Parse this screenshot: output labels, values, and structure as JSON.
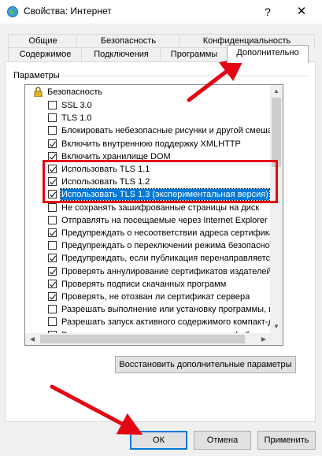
{
  "window": {
    "title": "Свойства: Интернет",
    "help_label": "?",
    "close_label": "✕",
    "icon": "internet-globe-icon"
  },
  "tabs_top": [
    {
      "label": "Общие"
    },
    {
      "label": "Безопасность"
    },
    {
      "label": "Конфиденциальность"
    }
  ],
  "tabs_bottom": [
    {
      "label": "Содержимое"
    },
    {
      "label": "Подключения"
    },
    {
      "label": "Программы"
    },
    {
      "label": "Дополнительно",
      "active": true
    }
  ],
  "settings": {
    "group_label": "Параметры",
    "category": "Безопасность",
    "items": [
      {
        "label": "SSL 3.0",
        "checked": false
      },
      {
        "label": "TLS 1.0",
        "checked": false
      },
      {
        "label": "Блокировать небезопасные рисунки и другой смешанн",
        "checked": false
      },
      {
        "label": "Включить внутреннюю поддержку XMLHTTP",
        "checked": true
      },
      {
        "label": "Включить хранилище DOM",
        "checked": true
      },
      {
        "label": "Использовать TLS 1.1",
        "checked": true
      },
      {
        "label": "Использовать TLS 1.2",
        "checked": true
      },
      {
        "label": "Использовать TLS 1.3 (экспериментальная версия)",
        "checked": true,
        "selected": true
      },
      {
        "label": "Не сохранять зашифрованные страницы на диск",
        "checked": false
      },
      {
        "label": "Отправлять на посещаемые через Internet Explorer ве",
        "checked": false
      },
      {
        "label": "Предупреждать о несоответствии адреса сертификат",
        "checked": true
      },
      {
        "label": "Предупреждать о переключении режима безопасност",
        "checked": false
      },
      {
        "label": "Предупреждать, если публикация перенаправляется",
        "checked": true
      },
      {
        "label": "Проверять аннулирование сертификатов издателей",
        "checked": true
      },
      {
        "label": "Проверять подписи скачанных программ",
        "checked": true
      },
      {
        "label": "Проверять, не отозван ли сертификат сервера",
        "checked": true
      },
      {
        "label": "Разрешать выполнение или установку программы, име",
        "checked": false
      },
      {
        "label": "Разрешать запуск активного содержимого компакт-ди",
        "checked": false
      },
      {
        "label": "Разрешать запуск активного содержимого файлов на",
        "checked": false
      }
    ]
  },
  "restore_button": "Восстановить дополнительные параметры",
  "footer": {
    "ok": "ОК",
    "cancel": "Отмена",
    "apply": "Применить"
  },
  "colors": {
    "selection": "#0078d7",
    "annotation": "#e30613"
  }
}
